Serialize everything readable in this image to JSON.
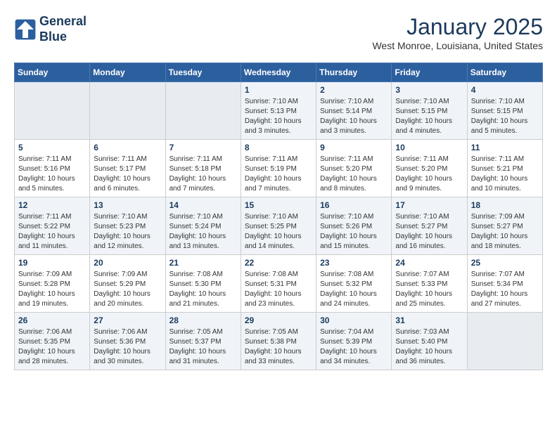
{
  "header": {
    "logo_line1": "General",
    "logo_line2": "Blue",
    "month": "January 2025",
    "location": "West Monroe, Louisiana, United States"
  },
  "days_of_week": [
    "Sunday",
    "Monday",
    "Tuesday",
    "Wednesday",
    "Thursday",
    "Friday",
    "Saturday"
  ],
  "weeks": [
    [
      {
        "num": "",
        "info": ""
      },
      {
        "num": "",
        "info": ""
      },
      {
        "num": "",
        "info": ""
      },
      {
        "num": "1",
        "info": "Sunrise: 7:10 AM\nSunset: 5:13 PM\nDaylight: 10 hours\nand 3 minutes."
      },
      {
        "num": "2",
        "info": "Sunrise: 7:10 AM\nSunset: 5:14 PM\nDaylight: 10 hours\nand 3 minutes."
      },
      {
        "num": "3",
        "info": "Sunrise: 7:10 AM\nSunset: 5:15 PM\nDaylight: 10 hours\nand 4 minutes."
      },
      {
        "num": "4",
        "info": "Sunrise: 7:10 AM\nSunset: 5:15 PM\nDaylight: 10 hours\nand 5 minutes."
      }
    ],
    [
      {
        "num": "5",
        "info": "Sunrise: 7:11 AM\nSunset: 5:16 PM\nDaylight: 10 hours\nand 5 minutes."
      },
      {
        "num": "6",
        "info": "Sunrise: 7:11 AM\nSunset: 5:17 PM\nDaylight: 10 hours\nand 6 minutes."
      },
      {
        "num": "7",
        "info": "Sunrise: 7:11 AM\nSunset: 5:18 PM\nDaylight: 10 hours\nand 7 minutes."
      },
      {
        "num": "8",
        "info": "Sunrise: 7:11 AM\nSunset: 5:19 PM\nDaylight: 10 hours\nand 7 minutes."
      },
      {
        "num": "9",
        "info": "Sunrise: 7:11 AM\nSunset: 5:20 PM\nDaylight: 10 hours\nand 8 minutes."
      },
      {
        "num": "10",
        "info": "Sunrise: 7:11 AM\nSunset: 5:20 PM\nDaylight: 10 hours\nand 9 minutes."
      },
      {
        "num": "11",
        "info": "Sunrise: 7:11 AM\nSunset: 5:21 PM\nDaylight: 10 hours\nand 10 minutes."
      }
    ],
    [
      {
        "num": "12",
        "info": "Sunrise: 7:11 AM\nSunset: 5:22 PM\nDaylight: 10 hours\nand 11 minutes."
      },
      {
        "num": "13",
        "info": "Sunrise: 7:10 AM\nSunset: 5:23 PM\nDaylight: 10 hours\nand 12 minutes."
      },
      {
        "num": "14",
        "info": "Sunrise: 7:10 AM\nSunset: 5:24 PM\nDaylight: 10 hours\nand 13 minutes."
      },
      {
        "num": "15",
        "info": "Sunrise: 7:10 AM\nSunset: 5:25 PM\nDaylight: 10 hours\nand 14 minutes."
      },
      {
        "num": "16",
        "info": "Sunrise: 7:10 AM\nSunset: 5:26 PM\nDaylight: 10 hours\nand 15 minutes."
      },
      {
        "num": "17",
        "info": "Sunrise: 7:10 AM\nSunset: 5:27 PM\nDaylight: 10 hours\nand 16 minutes."
      },
      {
        "num": "18",
        "info": "Sunrise: 7:09 AM\nSunset: 5:27 PM\nDaylight: 10 hours\nand 18 minutes."
      }
    ],
    [
      {
        "num": "19",
        "info": "Sunrise: 7:09 AM\nSunset: 5:28 PM\nDaylight: 10 hours\nand 19 minutes."
      },
      {
        "num": "20",
        "info": "Sunrise: 7:09 AM\nSunset: 5:29 PM\nDaylight: 10 hours\nand 20 minutes."
      },
      {
        "num": "21",
        "info": "Sunrise: 7:08 AM\nSunset: 5:30 PM\nDaylight: 10 hours\nand 21 minutes."
      },
      {
        "num": "22",
        "info": "Sunrise: 7:08 AM\nSunset: 5:31 PM\nDaylight: 10 hours\nand 23 minutes."
      },
      {
        "num": "23",
        "info": "Sunrise: 7:08 AM\nSunset: 5:32 PM\nDaylight: 10 hours\nand 24 minutes."
      },
      {
        "num": "24",
        "info": "Sunrise: 7:07 AM\nSunset: 5:33 PM\nDaylight: 10 hours\nand 25 minutes."
      },
      {
        "num": "25",
        "info": "Sunrise: 7:07 AM\nSunset: 5:34 PM\nDaylight: 10 hours\nand 27 minutes."
      }
    ],
    [
      {
        "num": "26",
        "info": "Sunrise: 7:06 AM\nSunset: 5:35 PM\nDaylight: 10 hours\nand 28 minutes."
      },
      {
        "num": "27",
        "info": "Sunrise: 7:06 AM\nSunset: 5:36 PM\nDaylight: 10 hours\nand 30 minutes."
      },
      {
        "num": "28",
        "info": "Sunrise: 7:05 AM\nSunset: 5:37 PM\nDaylight: 10 hours\nand 31 minutes."
      },
      {
        "num": "29",
        "info": "Sunrise: 7:05 AM\nSunset: 5:38 PM\nDaylight: 10 hours\nand 33 minutes."
      },
      {
        "num": "30",
        "info": "Sunrise: 7:04 AM\nSunset: 5:39 PM\nDaylight: 10 hours\nand 34 minutes."
      },
      {
        "num": "31",
        "info": "Sunrise: 7:03 AM\nSunset: 5:40 PM\nDaylight: 10 hours\nand 36 minutes."
      },
      {
        "num": "",
        "info": ""
      }
    ]
  ]
}
